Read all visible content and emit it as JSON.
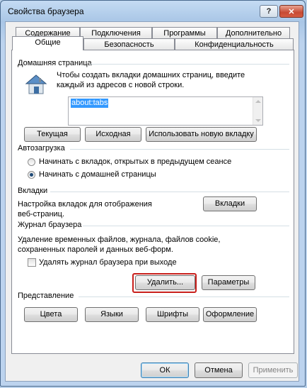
{
  "window": {
    "title": "Свойства браузера",
    "help_label": "?",
    "close_label": "✕"
  },
  "tabs": {
    "row1": [
      "Содержание",
      "Подключения",
      "Программы",
      "Дополнительно"
    ],
    "row2": [
      "Общие",
      "Безопасность",
      "Конфиденциальность"
    ]
  },
  "home": {
    "section": "Домашняя страница",
    "description": [
      "Чтобы создать вкладки домашних страниц, введите",
      "каждый из адресов с новой строки."
    ],
    "value": "about:tabs",
    "icon": "house-icon",
    "buttons": [
      "Текущая",
      "Исходная",
      "Использовать новую вкладку"
    ]
  },
  "startup": {
    "section": "Автозагрузка",
    "option1": "Начинать с вкладок, открытых в предыдущем сеансе",
    "option2": "Начинать с домашней страницы",
    "selected": "option2"
  },
  "tabs_section": {
    "section": "Вкладки",
    "description": [
      "Настройка вкладок для отображения",
      "веб-страниц."
    ],
    "button": "Вкладки"
  },
  "history": {
    "section": "Журнал браузера",
    "description": [
      "Удаление временных файлов, журнала, файлов cookie,",
      "сохраненных паролей и данных веб-форм."
    ],
    "checkbox": "Удалять журнал браузера при выходе",
    "checked": false,
    "delete_button": "Удалить...",
    "settings_button": "Параметры"
  },
  "appearance": {
    "section": "Представление",
    "buttons": [
      "Цвета",
      "Языки",
      "Шрифты",
      "Оформление"
    ]
  },
  "footer": {
    "ok": "ОК",
    "cancel": "Отмена",
    "apply": "Применить"
  },
  "colors": {
    "highlight": "#c8201c",
    "selection": "#3399ff"
  }
}
